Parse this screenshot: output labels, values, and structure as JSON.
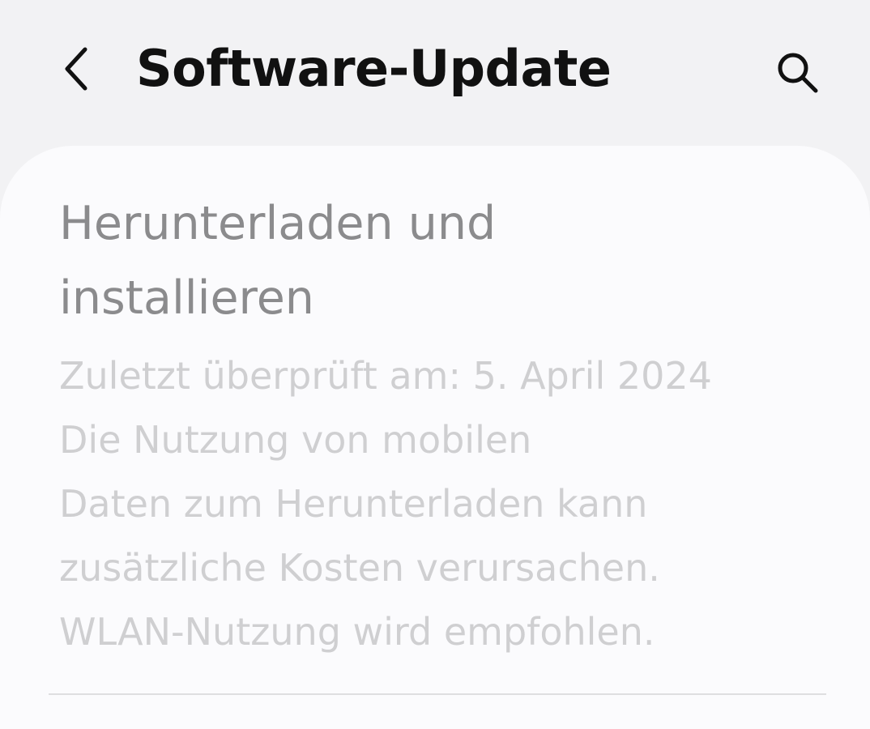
{
  "header": {
    "title": "Software-Update",
    "back_icon": "chevron-left-icon",
    "search_icon": "search-icon"
  },
  "main": {
    "item": {
      "title": "Herunterladen und\ninstallieren",
      "last_checked": "Zuletzt überprüft am: 5. April 2024",
      "description_lines": [
        "Die Nutzung von mobilen",
        "Daten zum Herunterladen kann",
        "zusätzliche Kosten verursachen.",
        "WLAN-Nutzung wird empfohlen."
      ]
    }
  },
  "colors": {
    "background": "#f2f2f4",
    "card": "#fbfbfd",
    "title_text": "#111111",
    "item_title_disabled": "#8b8b8d",
    "item_subtitle_disabled": "#cfcfd1",
    "divider": "#dedee0"
  }
}
